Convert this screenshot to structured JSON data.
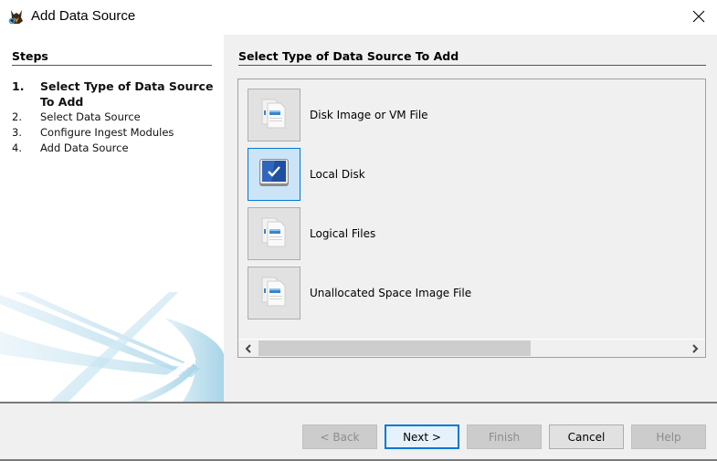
{
  "window": {
    "title": "Add Data Source",
    "app_icon": "autopsy-dog-icon",
    "close_icon": "close-icon"
  },
  "steps": {
    "title": "Steps",
    "items": [
      {
        "num": "1.",
        "label": "Select Type of Data Source To Add",
        "active": true
      },
      {
        "num": "2.",
        "label": "Select Data Source",
        "active": false
      },
      {
        "num": "3.",
        "label": "Configure Ingest Modules",
        "active": false
      },
      {
        "num": "4.",
        "label": "Add Data Source",
        "active": false
      }
    ]
  },
  "main": {
    "title": "Select Type of Data Source To Add",
    "options": [
      {
        "label": "Disk Image or VM File",
        "icon": "files-icon",
        "selected": false
      },
      {
        "label": "Local Disk",
        "icon": "local-disk-check-icon",
        "selected": true
      },
      {
        "label": "Logical Files",
        "icon": "files-icon",
        "selected": false
      },
      {
        "label": "Unallocated Space Image File",
        "icon": "files-icon",
        "selected": false
      }
    ],
    "scrollbar": {
      "left_icon": "chevron-left-icon",
      "right_icon": "chevron-right-icon"
    }
  },
  "buttons": {
    "back": "< Back",
    "next": "Next >",
    "finish": "Finish",
    "cancel": "Cancel",
    "help": "Help"
  },
  "colors": {
    "accent": "#0078d7",
    "selected_bg": "#cce4f7",
    "panel_bg": "#f0f0f0"
  }
}
